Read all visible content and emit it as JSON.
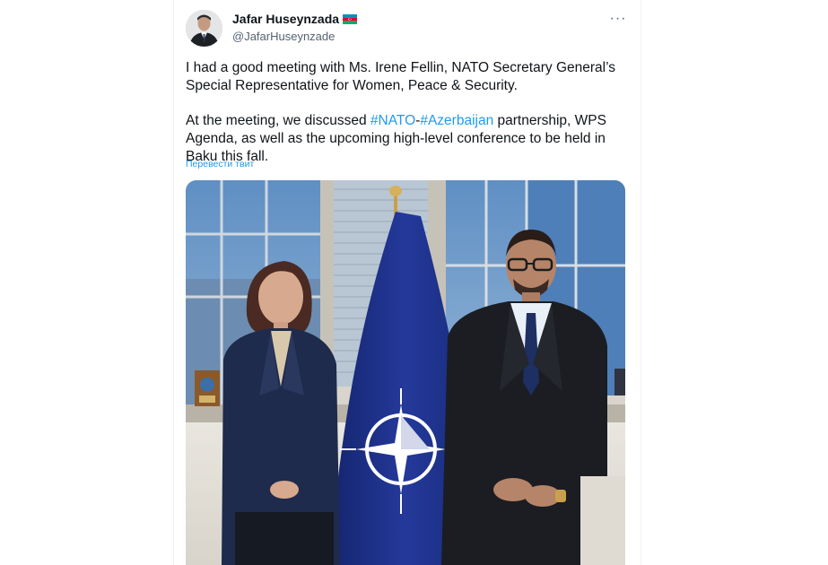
{
  "tweet": {
    "author_name": "Jafar Huseynzada",
    "handle": "@JafarHuseynzade",
    "more_label": "···",
    "paragraph1": "I had a good meeting with Ms. Irene Fellin, NATO Secretary General’s Special Representative for Women, Peace & Security.",
    "paragraph2_before": "At the meeting, we discussed ",
    "hashtag1": "#NATO",
    "dash": "-",
    "hashtag2": "#Azerbaijan",
    "paragraph2_after": " partnership, WPS Agenda, as well as the upcoming high-level conference to be held in Baku this fall.",
    "translate_label": "Перевести твит"
  },
  "colors": {
    "link": "#1d9bf0",
    "text": "#0f1419",
    "secondary": "#536471",
    "nato_blue": "#1c2f86"
  },
  "icons": {
    "flag": "azerbaijan-flag-icon",
    "more": "more-options-icon"
  }
}
